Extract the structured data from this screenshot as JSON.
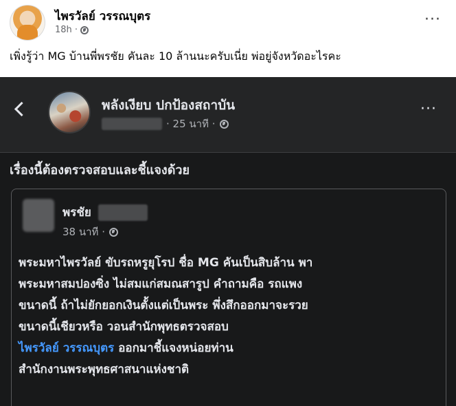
{
  "post": {
    "author": "ไพรวัลย์ วรรณบุตร",
    "time": "18h ·",
    "text": "เพิ่งรู้ว่า MG บ้านพี่พรชัย คันละ 10 ล้านนะครับเนี่ย พ่อยู่จังหวัดอะไรคะ",
    "more_label": "···"
  },
  "shared": {
    "page_name": "พลังเงียบ ปกป้องสถาบัน",
    "page_time": "· 25 นาที ·",
    "text": "เรื่องนี้ต้องตรวจสอบและชี้แจงด้วย",
    "more_label": "···",
    "quoted": {
      "name": "พรชัย",
      "time": "38 นาที ·",
      "lines": [
        "พระมหาไพรวัลย์ ขับรถหรูยุโรป ชื่อ MG คันเป็นสิบล้าน พา",
        "พระมหาสมปองซิ่ง ไม่สมแก่สมณสารูป คำถามคือ รถแพง",
        "ขนาดนี้ ถ้าไม่ยักยอกเงินตั้งแต่เป็นพระ พึ่งสึกออกมาจะรวย",
        "ขนาดนี้เชียวหรือ วอนสำนักพุทธตรวจสอบ"
      ],
      "mention": "ไพรวัลย์ วรรณบุตร",
      "after_mention": " ออกมาชี้แจงหน่อยท่าน",
      "last_line": "สำนักงานพระพุทธศาสนาแห่งชาติ"
    }
  }
}
